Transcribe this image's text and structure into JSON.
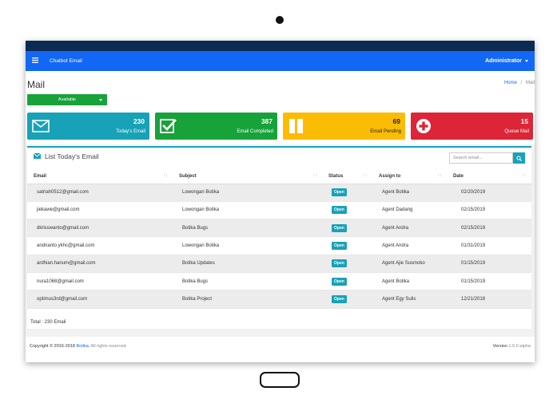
{
  "navbar": {
    "brand": "Chatbot Email",
    "user": "Administrator"
  },
  "page": {
    "title": "Mail",
    "breadcrumb_home": "Home",
    "breadcrumb_sep": "/",
    "breadcrumb_current": "Mail",
    "status_value": "Available"
  },
  "cards": [
    {
      "value": "230",
      "label": "Today's Email",
      "icon": "envelope-icon",
      "color": "#17a2b8"
    },
    {
      "value": "387",
      "label": "Email Completed",
      "icon": "check-square-icon",
      "color": "#18a23a"
    },
    {
      "value": "69",
      "label": "Email Pending",
      "icon": "pause-icon",
      "color": "#fbbc05"
    },
    {
      "value": "15",
      "label": "Queue Mail",
      "icon": "plus-circle-icon",
      "color": "#dc2537"
    }
  ],
  "panel": {
    "title": "List Today's Email",
    "search_placeholder": "Search email..."
  },
  "table": {
    "headers": [
      "Email",
      "Subject",
      "Status",
      "Assign to",
      "Date"
    ],
    "rows": [
      {
        "email": "satriah0512@gmail.com",
        "subject": "Lowongan Botika",
        "status": "Open",
        "assign": "Agent Botika",
        "date": "02/20/2019"
      },
      {
        "email": "jiekawe@gmail.com",
        "subject": "Lowongan Botika",
        "status": "Open",
        "assign": "Agent Dadang",
        "date": "02/15/2019"
      },
      {
        "email": "dkrisswanto@gmail.com",
        "subject": "Botika Bugs",
        "status": "Open",
        "assign": "Agent Andra",
        "date": "02/15/2019"
      },
      {
        "email": "andrianto.ykhc@gmail.com",
        "subject": "Lowongan Botika",
        "status": "Open",
        "assign": "Agent Andra",
        "date": "01/31/2019"
      },
      {
        "email": "ardhian.hanum@gmail.com",
        "subject": "Botika Updates",
        "status": "Open",
        "assign": "Agent Ajie Susmoko",
        "date": "01/15/2019"
      },
      {
        "email": "nura1068@gmail.com",
        "subject": "Botika Bugs",
        "status": "Open",
        "assign": "Agent Botika",
        "date": "01/15/2019"
      },
      {
        "email": "optimus3rd@gmail.com",
        "subject": "Botika Project",
        "status": "Open",
        "assign": "Agent Egy Sulis",
        "date": "12/21/2018"
      }
    ],
    "total": "Total :  230 Email"
  },
  "footer": {
    "copyright": "Copyright © 2016-2018",
    "brand": "Botika.",
    "rights": "All rights reserved.",
    "version_label": "Version",
    "version_value": "1.0.0-alpha"
  }
}
